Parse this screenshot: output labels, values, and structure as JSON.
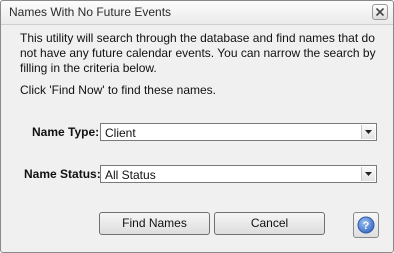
{
  "window": {
    "title": "Names With No Future Events"
  },
  "content": {
    "description": "This utility will search through the database and find names that do not have any future calendar events.  You can narrow the search by filling in the criteria below.",
    "hint": "Click 'Find Now' to find these names."
  },
  "form": {
    "name_type": {
      "label": "Name Type:",
      "value": "Client"
    },
    "name_status": {
      "label": "Name Status:",
      "value": "All Status"
    }
  },
  "buttons": {
    "find_names": "Find Names",
    "cancel": "Cancel"
  },
  "icons": {
    "close": "close-icon",
    "dropdown": "chevron-down-icon",
    "help": "help-icon"
  },
  "colors": {
    "help_accent": "#3d6fc4"
  }
}
